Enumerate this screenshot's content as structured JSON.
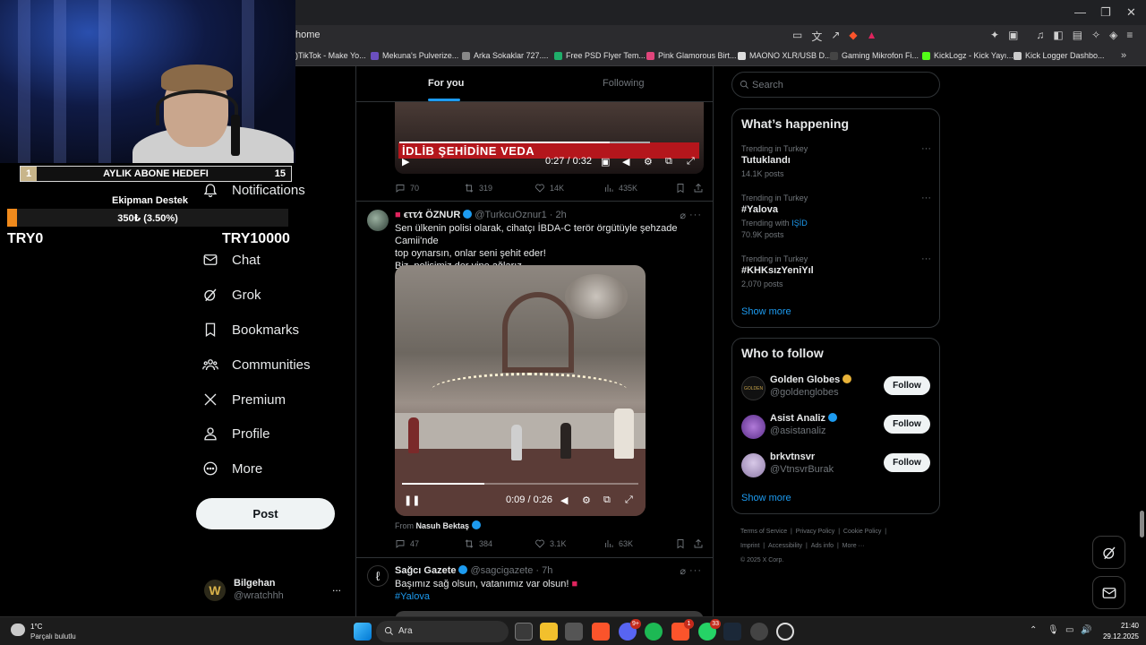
{
  "browser": {
    "url": "home",
    "bookmarks": [
      {
        "label": ")TikTok - Make Yo...",
        "color": "#111111"
      },
      {
        "label": "Mekuna's Pulverize...",
        "color": "#6b4fbf"
      },
      {
        "label": "Arka Sokaklar 727....",
        "color": "#888888"
      },
      {
        "label": "Free PSD Flyer Tem...",
        "color": "#1fae6a"
      },
      {
        "label": "Pink Glamorous Birt...",
        "color": "#e0457b"
      },
      {
        "label": "MAONO XLR/USB D...",
        "color": "#dddddd"
      },
      {
        "label": "Gaming Mikrofon Fi...",
        "color": "#222222"
      },
      {
        "label": "KickLogz - Kick Yayı...",
        "color": "#53fc18"
      },
      {
        "label": "Kick Logger Dashbo...",
        "color": "#cccccc"
      }
    ],
    "bookmarks_more": "»",
    "window_controls": [
      "—",
      "❐",
      "✕"
    ]
  },
  "overlay": {
    "goal1_number": "1",
    "goal1_title": "AYLIK ABONE HEDEFI",
    "goal1_count": "15",
    "goal2_title": "Ekipman Destek",
    "goal2_progress_text": "350₺ (3.50%)",
    "goal2_progress": 0.035,
    "goal2_start": "TRY0",
    "goal2_end": "TRY10000"
  },
  "nav": {
    "items": [
      {
        "label": "Notifications",
        "icon": "bell-icon"
      },
      {
        "label": "Chat",
        "icon": "chat-icon"
      },
      {
        "label": "Grok",
        "icon": "grok-icon"
      },
      {
        "label": "Bookmarks",
        "icon": "bookmark-icon"
      },
      {
        "label": "Communities",
        "icon": "communities-icon"
      },
      {
        "label": "Premium",
        "icon": "x-logo-icon"
      },
      {
        "label": "Profile",
        "icon": "profile-icon"
      },
      {
        "label": "More",
        "icon": "more-icon"
      }
    ],
    "post_label": "Post",
    "account": {
      "name": "Bilgehan",
      "handle": "@wratchhh",
      "more": "..."
    }
  },
  "timeline": {
    "tabs": [
      {
        "label": "For you",
        "active": true
      },
      {
        "label": "Following",
        "active": false
      }
    ],
    "tweet1": {
      "video_banner": "İDLİB ŞEHİDİNE VEDA",
      "video_time": "0:27 / 0:32",
      "video_progress": 0.84,
      "replies": "70",
      "retweets": "319",
      "likes": "14K",
      "views": "435K"
    },
    "tweet2": {
      "name": "ϵττ⁄ɪ ÖZNUR",
      "handle": "@TurkcuOznur1",
      "time": "· 2h",
      "text_line1": "Sen ülkenin polisi olarak, cihatçı İBDA-C terör örgütüyle şehzade Camii'nde",
      "text_line2": "top oynarsın, onlar seni şehit eder!",
      "text_line3": "Biz, polisimiz der yine  ağlarız.",
      "video_time": "0:09 / 0:26",
      "video_progress": 0.35,
      "from_label": "From",
      "from_name": "Nasuh Bektaş",
      "replies": "47",
      "retweets": "384",
      "likes": "3.1K",
      "views": "63K"
    },
    "tweet3": {
      "name": "Sağcı Gazete",
      "handle": "@sagcigazete",
      "time": "· 7h",
      "text": "Başımız sağ olsun, vatanımız var olsun!",
      "hashtag": "#Yalova"
    }
  },
  "sidebar": {
    "search_placeholder": "Search",
    "happening_title": "What’s happening",
    "trends": [
      {
        "context": "Trending in Turkey",
        "name": "Tutuklandı",
        "extra": "",
        "posts": "14.1K posts"
      },
      {
        "context": "Trending in Turkey",
        "name": "#Yalova",
        "extra": "Trending with",
        "extra_link": "IŞİD",
        "posts": "70.9K posts"
      },
      {
        "context": "Trending in Turkey",
        "name": "#KHKsızYeniYıl",
        "extra": "",
        "posts": "2,070 posts"
      }
    ],
    "show_more": "Show more",
    "follow_title": "Who to follow",
    "follow": [
      {
        "name": "Golden Globes",
        "handle": "@goldenglobes",
        "badge": "gold",
        "button": "Follow"
      },
      {
        "name": "Asist Analiz",
        "handle": "@asistanaliz",
        "badge": "blue",
        "button": "Follow"
      },
      {
        "name": "brkvtnsvr",
        "handle": "@VtnsvrBurak",
        "badge": "",
        "button": "Follow"
      }
    ],
    "follow_show_more": "Show more",
    "footer_line1": [
      "Terms of Service",
      "|",
      "Privacy Policy",
      "|",
      "Cookie Policy",
      "|"
    ],
    "footer_line2": [
      "Imprint",
      "|",
      "Accessibility",
      "|",
      "Ads info",
      "|",
      "More ···"
    ],
    "footer_line3": "© 2025 X Corp."
  },
  "taskbar": {
    "weather_temp": "1°C",
    "weather_desc": "Parçalı bulutlu",
    "search_label": "Ara",
    "badges": {
      "discord": "9+",
      "brave2": "1",
      "whatsapp": "33"
    },
    "time": "21:40",
    "date": "29.12.2025"
  },
  "colors": {
    "accent": "#1d9bf0",
    "background": "#000000",
    "muted": "#71767b"
  }
}
